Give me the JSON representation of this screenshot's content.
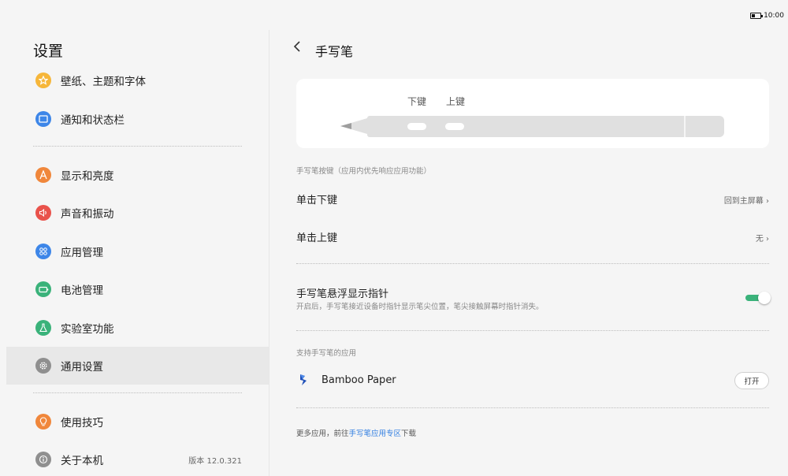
{
  "status_bar": {
    "time": "10:00",
    "battery_icon": "battery-icon"
  },
  "sidebar": {
    "title": "设置",
    "items": [
      {
        "label": "壁纸、主题和字体",
        "icon": "star-icon",
        "color": "#f6b63a"
      },
      {
        "label": "通知和状态栏",
        "icon": "screen-icon",
        "color": "#3d86e8"
      },
      {
        "label": "显示和亮度",
        "icon": "letter-a-icon",
        "color": "#f0873b"
      },
      {
        "label": "声音和振动",
        "icon": "speaker-icon",
        "color": "#e9524b"
      },
      {
        "label": "应用管理",
        "icon": "apps-grid-icon",
        "color": "#3d86e8"
      },
      {
        "label": "电池管理",
        "icon": "battery-icon",
        "color": "#3ab27a"
      },
      {
        "label": "实验室功能",
        "icon": "flask-icon",
        "color": "#3ab27a"
      },
      {
        "label": "通用设置",
        "icon": "gear-icon",
        "color": "#8f8f8f"
      },
      {
        "label": "使用技巧",
        "icon": "lightbulb-icon",
        "color": "#f0873b"
      },
      {
        "label": "关于本机",
        "icon": "info-icon",
        "color": "#8f8f8f",
        "meta": "版本 12.0.321"
      }
    ],
    "selected_index": 7
  },
  "page": {
    "back_icon": "chevron-left-icon",
    "title": "手写笔",
    "pen_illustration": {
      "lower_button_label": "下键",
      "upper_button_label": "上键"
    },
    "buttons_section_label": "手写笔按键（应用内优先响应应用功能）",
    "rows": [
      {
        "label": "单击下键",
        "value": "回到主屏幕 ›"
      },
      {
        "label": "单击上键",
        "value": "无 ›"
      }
    ],
    "hover_pointer": {
      "label": "手写笔悬浮显示指针",
      "description": "开启后，手写笔接近设备时指针显示笔尖位置，笔尖接触屏幕时指针消失。",
      "enabled": true,
      "toggle_color": "#3ab27a"
    },
    "apps_section_label": "支持手写笔的应用",
    "app": {
      "name": "Bamboo Paper",
      "icon": "bamboo-paper-icon",
      "button": "打开"
    },
    "footer": {
      "prefix": "更多应用，前往",
      "link": "手写笔应用专区",
      "suffix": "下载"
    }
  }
}
